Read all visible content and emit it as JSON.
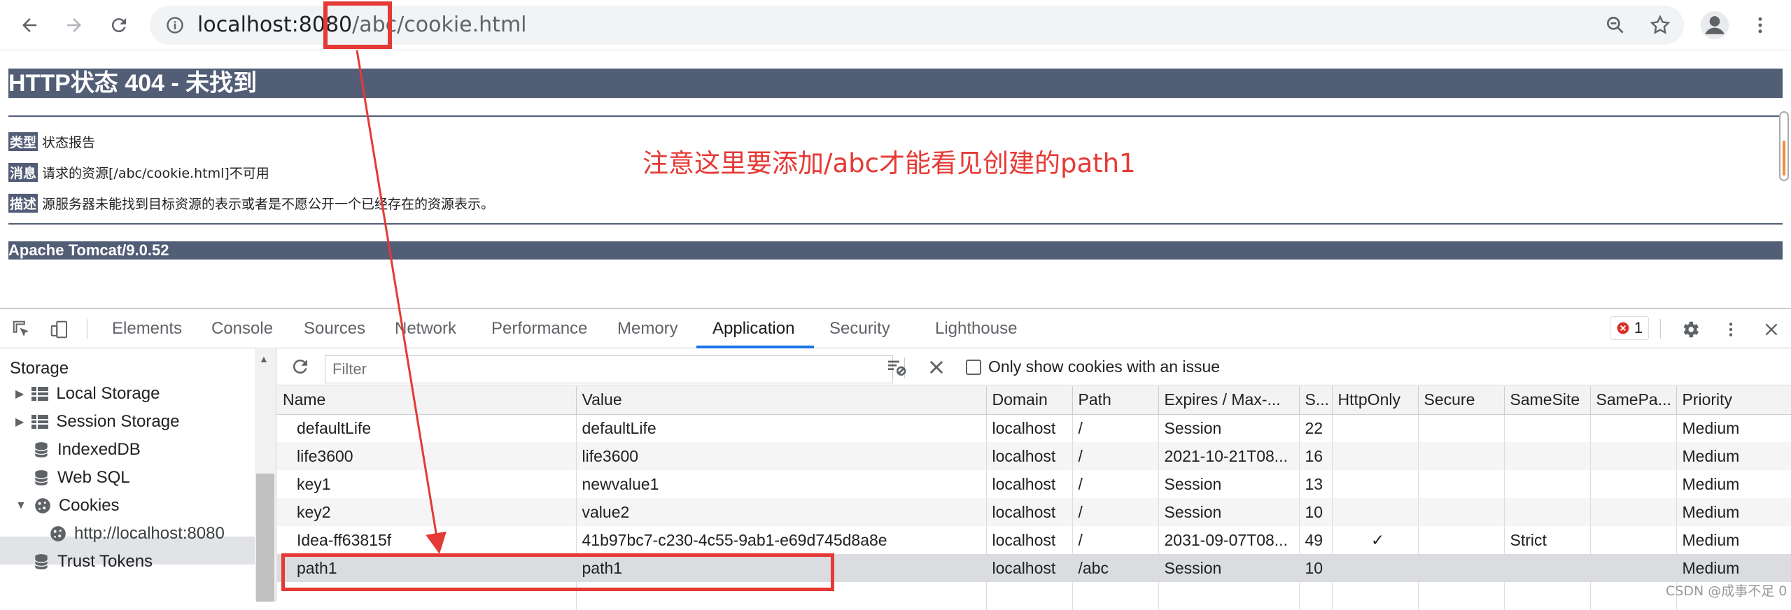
{
  "browser": {
    "url_host": "localhost:8080",
    "url_path": "/abc/cookie.html",
    "icons": [
      "back-icon",
      "forward-icon",
      "reload-icon",
      "info-icon",
      "zoom-icon",
      "star-icon",
      "profile-icon",
      "menu-icon"
    ]
  },
  "page": {
    "title": "HTTP状态 404 - 未找到",
    "type_label": "类型",
    "type_value": "状态报告",
    "message_label": "消息",
    "message_value": "请求的资源[/abc/cookie.html]不可用",
    "desc_label": "描述",
    "desc_value": "源服务器未能找到目标资源的表示或者是不愿公开一个已经存在的资源表示。",
    "server": "Apache Tomcat/9.0.52",
    "annotation": "注意这里要添加/abc才能看见创建的path1"
  },
  "devtools": {
    "tabs": [
      "Elements",
      "Console",
      "Sources",
      "Network",
      "Performance",
      "Memory",
      "Application",
      "Security",
      "Lighthouse"
    ],
    "active_tab": "Application",
    "error_count": "1"
  },
  "sidebar": {
    "heading": "Storage",
    "items": [
      "Local Storage",
      "Session Storage",
      "IndexedDB",
      "Web SQL",
      "Cookies",
      "http://localhost:8080",
      "Trust Tokens"
    ]
  },
  "cookies": {
    "filter_placeholder": "Filter",
    "only_issue_label": "Only show cookies with an issue",
    "columns": [
      "Name",
      "Value",
      "Domain",
      "Path",
      "Expires / Max-...",
      "S...",
      "HttpOnly",
      "Secure",
      "SameSite",
      "SamePa...",
      "Priority"
    ],
    "rows": [
      [
        "defaultLife",
        "defaultLife",
        "localhost",
        "/",
        "Session",
        "22",
        "",
        "",
        "",
        "",
        "Medium"
      ],
      [
        "life3600",
        "life3600",
        "localhost",
        "/",
        "2021-10-21T08...",
        "16",
        "",
        "",
        "",
        "",
        "Medium"
      ],
      [
        "key1",
        "newvalue1",
        "localhost",
        "/",
        "Session",
        "13",
        "",
        "",
        "",
        "",
        "Medium"
      ],
      [
        "key2",
        "value2",
        "localhost",
        "/",
        "Session",
        "10",
        "",
        "",
        "",
        "",
        "Medium"
      ],
      [
        "Idea-ff63815f",
        "41b97bc7-c230-4c55-9ab1-e69d745d8a8e",
        "localhost",
        "/",
        "2031-09-07T08...",
        "49",
        "✓",
        "",
        "Strict",
        "",
        "Medium"
      ],
      [
        "path1",
        "path1",
        "localhost",
        "/abc",
        "Session",
        "10",
        "",
        "",
        "",
        "",
        "Medium"
      ]
    ]
  },
  "watermark": "CSDN @成事不足 0",
  "colors": {
    "accent": "#1a73e8",
    "annotation": "#e53935",
    "tomcat": "#525d76"
  }
}
